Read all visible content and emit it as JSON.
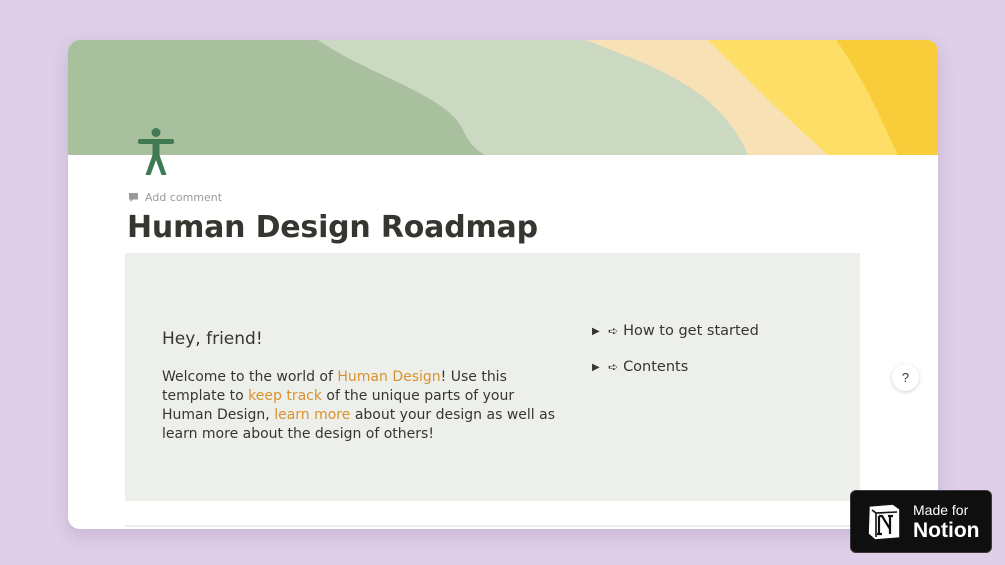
{
  "page": {
    "icon": "person-standing-icon",
    "add_comment": "Add comment",
    "title": "Human Design Roadmap"
  },
  "callout": {
    "greeting": "Hey, friend!",
    "welcome": {
      "part1": "Welcome to the world of ",
      "link1": "Human Design",
      "part2": "! Use this template to ",
      "link2": "keep track",
      "part3": " of the unique parts of your Human Design, ",
      "link3": "learn more",
      "part4": " about your design as well as learn more about the design of others!"
    },
    "toggles": [
      {
        "triangle": "▶",
        "arrow": "➪",
        "label": "How to get started"
      },
      {
        "triangle": "▶",
        "arrow": "➪",
        "label": "Contents"
      }
    ]
  },
  "help": {
    "label": "?"
  },
  "badge": {
    "line1": "Made for",
    "line2": "Notion"
  },
  "colors": {
    "background": "#dfcfe8",
    "link": "#d9912f",
    "callout_bg": "#edf0ea",
    "icon_green": "#3f7a52"
  }
}
